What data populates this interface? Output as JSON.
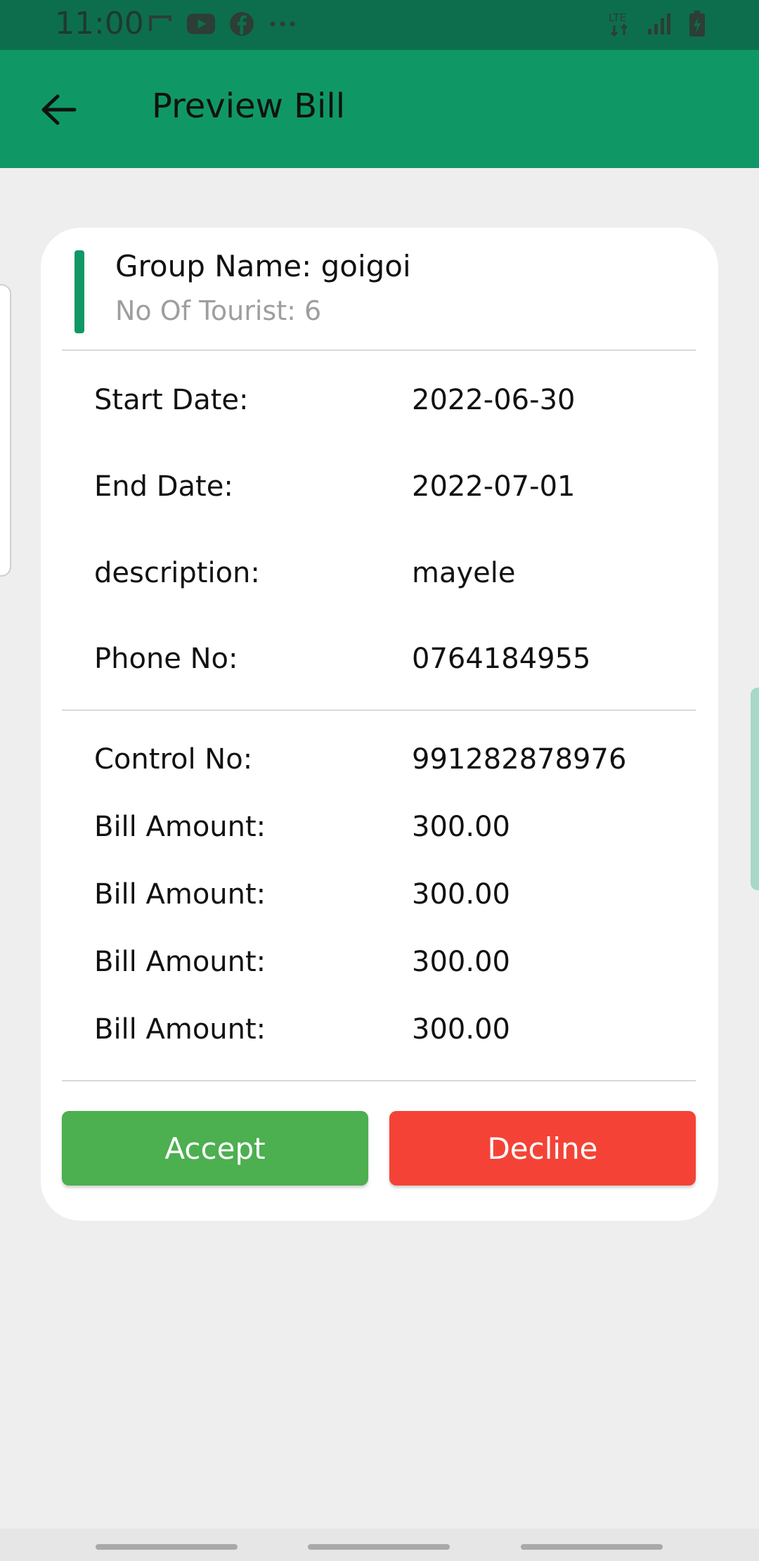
{
  "status_bar": {
    "time": "11:00",
    "icons_left": [
      "screen-cast-icon",
      "youtube-icon",
      "facebook-icon",
      "more-dots-icon"
    ],
    "network": "LTE",
    "icons_right": [
      "lte-data-icon",
      "signal-icon",
      "battery-charging-icon"
    ]
  },
  "app_bar": {
    "title": "Preview Bill",
    "back_icon": "arrow-left-icon"
  },
  "card": {
    "group_name": "Group Name: goigoi",
    "tourist_count": "No Of Tourist: 6",
    "accent_color": "#0f9865",
    "details": [
      {
        "label": "Start Date:",
        "value": "2022-06-30"
      },
      {
        "label": "End Date:",
        "value": "2022-07-01"
      },
      {
        "label": "description:",
        "value": "mayele"
      },
      {
        "label": "Phone No:",
        "value": "0764184955"
      }
    ],
    "billing": [
      {
        "label": "Control No:",
        "value": "991282878976"
      },
      {
        "label": "Bill Amount:",
        "value": "300.00"
      },
      {
        "label": "Bill Amount:",
        "value": "300.00"
      },
      {
        "label": "Bill Amount:",
        "value": "300.00"
      },
      {
        "label": "Bill Amount:",
        "value": "300.00"
      }
    ],
    "accept_label": "Accept",
    "decline_label": "Decline"
  },
  "colors": {
    "status_bar": "#0d6e4e",
    "app_bar": "#0f9865",
    "accept": "#4caf50",
    "decline": "#f44336",
    "background": "#eeeeee"
  }
}
